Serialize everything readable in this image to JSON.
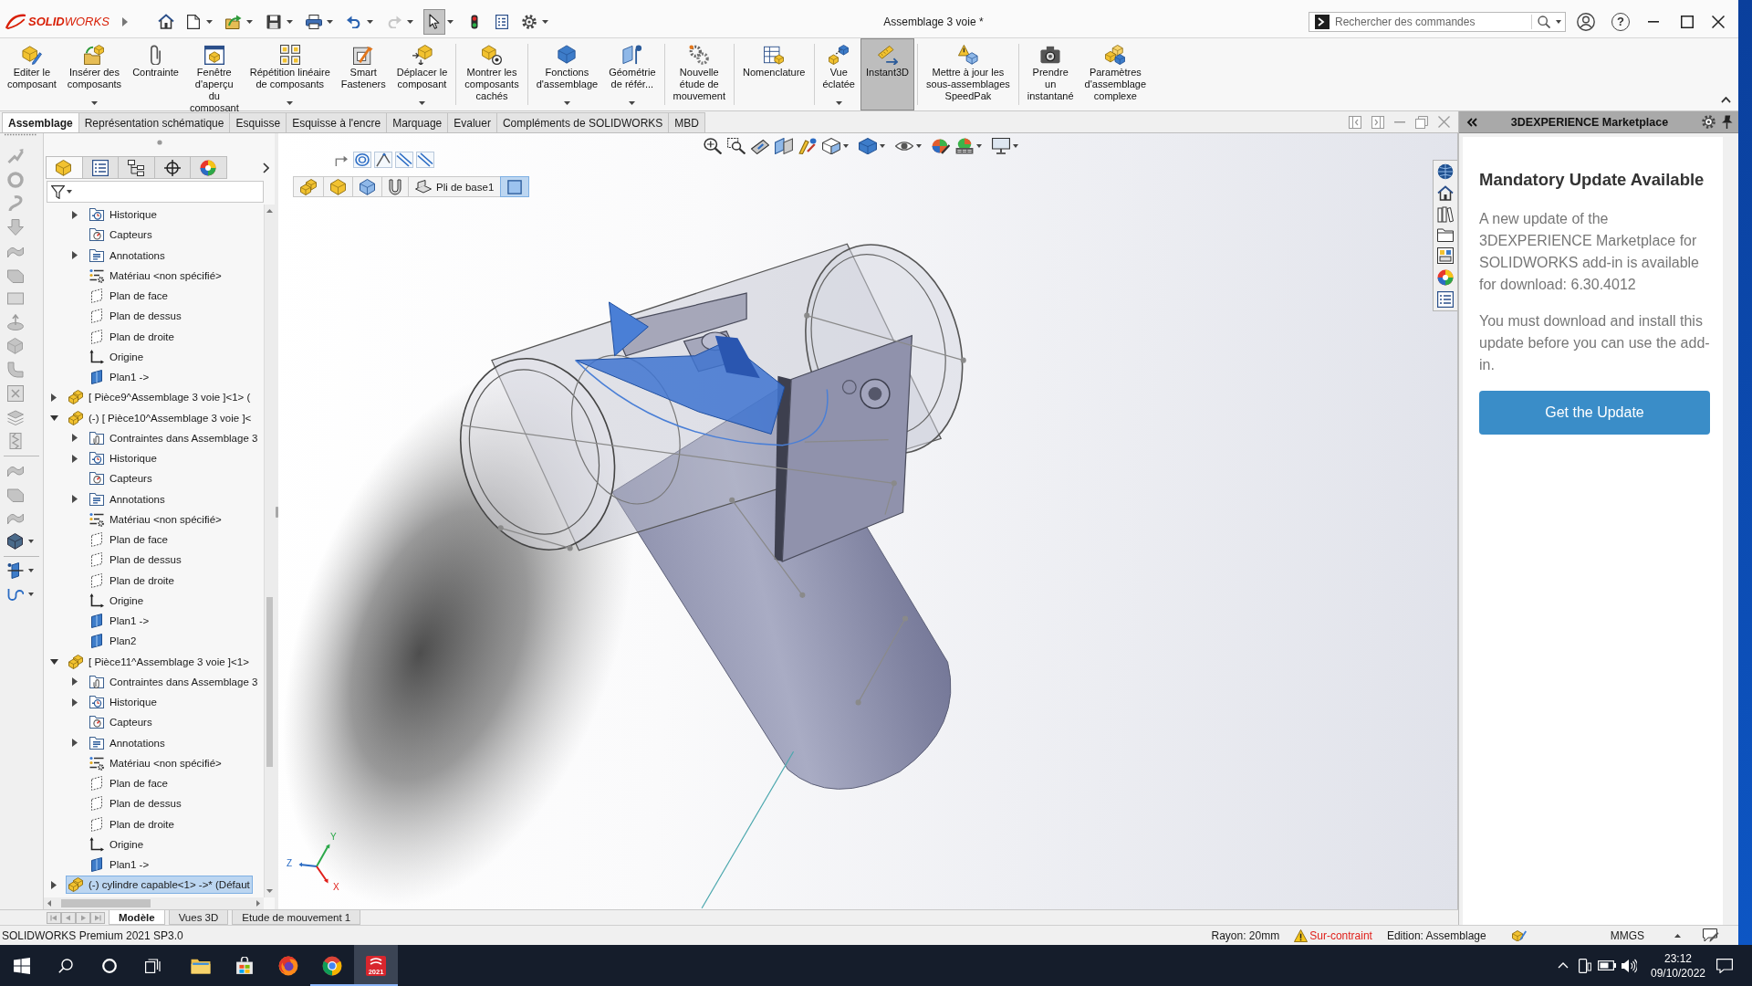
{
  "title_bar": {
    "logo": "**SOLID**WORKS",
    "quick_access": [
      {
        "dropdown": false,
        "disabled": false,
        "pressed": false
      },
      {
        "dropdown": true,
        "disabled": false,
        "pressed": false
      },
      {
        "dropdown": true,
        "disabled": false,
        "pressed": false
      },
      {
        "dropdown": true,
        "disabled": false,
        "pressed": false
      },
      {
        "dropdown": true,
        "disabled": false,
        "pressed": false
      },
      {
        "dropdown": true,
        "disabled": false,
        "pressed": false
      },
      {
        "dropdown": true,
        "disabled": true,
        "pressed": false
      },
      {
        "dropdown": true,
        "disabled": false,
        "pressed": true
      },
      {
        "dropdown": false,
        "disabled": false,
        "pressed": false
      },
      {
        "dropdown": false,
        "disabled": false,
        "pressed": false
      },
      {
        "dropdown": true,
        "disabled": false,
        "pressed": false
      }
    ],
    "document_title": "Assemblage 3 voie *",
    "search": {
      "placeholder": "Rechercher des commandes"
    },
    "help": "?"
  },
  "ribbon": {
    "groups": [
      {
        "commands": [
          {
            "label": "Editer le\ncomposant",
            "dropdown": false,
            "pressed": false
          },
          {
            "label": "Insérer des\ncomposants",
            "dropdown": true,
            "pressed": false
          },
          {
            "label": "Contrainte",
            "dropdown": false,
            "pressed": false
          },
          {
            "label": "Fenêtre\nd'aperçu\ndu\ncomposant",
            "dropdown": false,
            "pressed": false
          },
          {
            "label": "Répétition linéaire\nde composants",
            "dropdown": true,
            "pressed": false
          },
          {
            "label": "Smart\nFasteners",
            "dropdown": false,
            "pressed": false
          },
          {
            "label": "Déplacer le\ncomposant",
            "dropdown": true,
            "pressed": false
          }
        ]
      },
      {
        "commands": [
          {
            "label": "Montrer les\ncomposants\ncachés",
            "dropdown": false,
            "pressed": false
          }
        ]
      },
      {
        "commands": [
          {
            "label": "Fonctions\nd'assemblage",
            "dropdown": true,
            "pressed": false
          },
          {
            "label": "Géométrie\nde référ...",
            "dropdown": true,
            "pressed": false
          }
        ]
      },
      {
        "commands": [
          {
            "label": "Nouvelle\nétude de\nmouvement",
            "dropdown": false,
            "pressed": false
          }
        ]
      },
      {
        "commands": [
          {
            "label": "Nomenclature",
            "dropdown": false,
            "pressed": false
          }
        ]
      },
      {
        "commands": [
          {
            "label": "Vue\néclatée",
            "dropdown": true,
            "pressed": false
          },
          {
            "label": "Instant3D",
            "dropdown": false,
            "pressed": true
          }
        ]
      },
      {
        "commands": [
          {
            "label": "Mettre à jour les\nsous-assemblages\nSpeedPak",
            "dropdown": false,
            "pressed": false
          }
        ]
      },
      {
        "commands": [
          {
            "label": "Prendre\nun\ninstantané",
            "dropdown": false,
            "pressed": false
          },
          {
            "label": "Paramètres\nd'assemblage\ncomplexe",
            "dropdown": false,
            "pressed": false
          }
        ]
      }
    ]
  },
  "command_tabs": [
    {
      "label": "Assemblage",
      "selected": true
    },
    {
      "label": "Représentation schématique",
      "selected": false
    },
    {
      "label": "Esquisse",
      "selected": false
    },
    {
      "label": "Esquisse à l'encre",
      "selected": false
    },
    {
      "label": "Marquage",
      "selected": false
    },
    {
      "label": "Evaluer",
      "selected": false
    },
    {
      "label": "Compléments de SOLIDWORKS",
      "selected": false
    },
    {
      "label": "MBD",
      "selected": false
    }
  ],
  "feature_manager": {
    "tabs": [
      {
        "selected": true
      },
      {
        "selected": false
      },
      {
        "selected": false
      },
      {
        "selected": false
      },
      {
        "selected": false
      }
    ],
    "items": [
      {
        "children": [
          {
            "label": "Historique",
            "kind": "history",
            "expanded": false,
            "selected": false
          },
          {
            "label": "Capteurs",
            "kind": "sensors",
            "selected": false
          },
          {
            "label": "Annotations",
            "kind": "annotations",
            "expanded": false,
            "selected": false
          },
          {
            "label": "Matériau <non spécifié>",
            "kind": "material",
            "selected": false
          },
          {
            "label": "Plan de face",
            "kind": "plane",
            "selected": false
          },
          {
            "label": "Plan de dessus",
            "kind": "plane",
            "selected": false
          },
          {
            "label": "Plan de droite",
            "kind": "plane",
            "selected": false
          },
          {
            "label": "Origine",
            "kind": "origin",
            "selected": false
          },
          {
            "label": "Plan1 ->",
            "kind": "sketch",
            "selected": false
          }
        ]
      },
      {
        "label": "[ Pièce9^Assemblage 3 voie ]<1> (",
        "kind": "part",
        "expanded": false,
        "selected": false
      },
      {
        "label": "(-) [ Pièce10^Assemblage 3 voie ]<",
        "kind": "part",
        "expanded": true,
        "selected": false,
        "children": [
          {
            "label": "Contraintes dans Assemblage 3",
            "kind": "mates",
            "expanded": false,
            "selected": false
          },
          {
            "label": "Historique",
            "kind": "history",
            "expanded": false,
            "selected": false
          },
          {
            "label": "Capteurs",
            "kind": "sensors",
            "selected": false
          },
          {
            "label": "Annotations",
            "kind": "annotations",
            "expanded": false,
            "selected": false
          },
          {
            "label": "Matériau <non spécifié>",
            "kind": "material",
            "selected": false
          },
          {
            "label": "Plan de face",
            "kind": "plane",
            "selected": false
          },
          {
            "label": "Plan de dessus",
            "kind": "plane",
            "selected": false
          },
          {
            "label": "Plan de droite",
            "kind": "plane",
            "selected": false
          },
          {
            "label": "Origine",
            "kind": "origin",
            "selected": false
          },
          {
            "label": "Plan1 ->",
            "kind": "sketch",
            "selected": false
          },
          {
            "label": "Plan2",
            "kind": "sketch",
            "selected": false
          }
        ]
      },
      {
        "label": "[ Pièce11^Assemblage 3 voie ]<1>",
        "kind": "part",
        "expanded": true,
        "selected": false,
        "children": [
          {
            "label": "Contraintes dans Assemblage 3",
            "kind": "mates",
            "expanded": false,
            "selected": false
          },
          {
            "label": "Historique",
            "kind": "history",
            "expanded": false,
            "selected": false
          },
          {
            "label": "Capteurs",
            "kind": "sensors",
            "selected": false
          },
          {
            "label": "Annotations",
            "kind": "annotations",
            "expanded": false,
            "selected": false
          },
          {
            "label": "Matériau <non spécifié>",
            "kind": "material",
            "selected": false
          },
          {
            "label": "Plan de face",
            "kind": "plane",
            "selected": false
          },
          {
            "label": "Plan de dessus",
            "kind": "plane",
            "selected": false
          },
          {
            "label": "Plan de droite",
            "kind": "plane",
            "selected": false
          },
          {
            "label": "Origine",
            "kind": "origin",
            "selected": false
          },
          {
            "label": "Plan1 ->",
            "kind": "sketch",
            "selected": false
          }
        ]
      },
      {
        "label": "(-) cylindre capable<1> ->* (Défaut",
        "kind": "part",
        "expanded": false,
        "selected": true
      }
    ]
  },
  "viewport": {
    "breadcrumb": [
      {
        "selected": false
      },
      {
        "selected": false
      },
      {
        "selected": false
      },
      {
        "selected": false
      },
      {
        "label": "Pli de base1",
        "selected": false
      },
      {
        "selected": true
      }
    ],
    "axis_triad": {
      "y": "Y",
      "z": "Z",
      "x": "X"
    }
  },
  "task_pane": {
    "title": "3DEXPERIENCE Marketplace",
    "heading": "Mandatory Update Available",
    "paragraphs": [
      "A new update of the 3DEXPERIENCE Marketplace for SOLIDWORKS add-in is available for download: 6.30.4012",
      "You must download and install this update before you can use the add-in."
    ],
    "button": "Get the Update"
  },
  "model_tabs": [
    {
      "label": "Modèle",
      "selected": true
    },
    {
      "label": "Vues 3D",
      "selected": false
    },
    {
      "label": "Etude de mouvement 1",
      "selected": false
    }
  ],
  "status_bar": {
    "product": "SOLIDWORKS Premium 2021 SP3.0",
    "fields": [
      {
        "text": "Rayon: 20mm",
        "kind": "info"
      },
      {
        "text": "Sur-contraint",
        "kind": "warning"
      },
      {
        "text": "Edition: Assemblage",
        "kind": "info"
      }
    ],
    "units": "MMGS"
  },
  "taskbar": {
    "apps": [
      {
        "running": false,
        "selected": false
      },
      {
        "running": false,
        "selected": false
      },
      {
        "running": false,
        "selected": false
      },
      {
        "running": true,
        "selected": false
      },
      {
        "label": "2021",
        "running": true,
        "selected": true
      }
    ],
    "time": "23:12",
    "date": "09/10/2022"
  }
}
